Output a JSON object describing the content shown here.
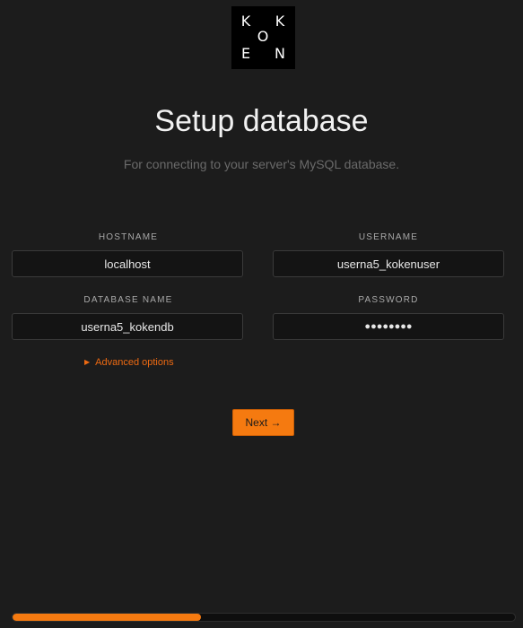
{
  "logo": {
    "letters": [
      "K",
      "K",
      "O",
      "E",
      "N"
    ]
  },
  "header": {
    "title": "Setup database",
    "subtitle": "For connecting to your server's MySQL database."
  },
  "form": {
    "hostname": {
      "label": "HOSTNAME",
      "value": "localhost"
    },
    "username": {
      "label": "USERNAME",
      "value": "userna5_kokenuser"
    },
    "database_name": {
      "label": "DATABASE NAME",
      "value": "userna5_kokendb"
    },
    "password": {
      "label": "PASSWORD",
      "masked_value": "●●●●●●●●"
    },
    "advanced_options": {
      "arrow": "▶",
      "label": "Advanced options"
    }
  },
  "actions": {
    "next_label": "Next →"
  },
  "progress": {
    "fraction": 0.375
  },
  "colors": {
    "accent": "#f57a10",
    "background": "#1c1c1c"
  }
}
